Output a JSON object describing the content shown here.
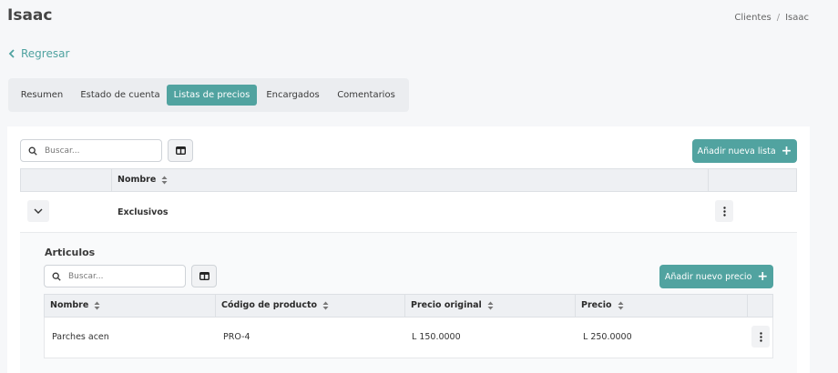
{
  "header": {
    "title": "Isaac",
    "breadcrumb": [
      "Clientes",
      "Isaac"
    ],
    "breadcrumb_separator": "/"
  },
  "back_link": {
    "label": "Regresar",
    "icon": "chevron-left-icon"
  },
  "tabs": [
    {
      "label": "Resumen",
      "active": false
    },
    {
      "label": "Estado de cuenta",
      "active": false
    },
    {
      "label": "Listas de precios",
      "active": true
    },
    {
      "label": "Encargados",
      "active": false
    },
    {
      "label": "Comentarios",
      "active": false
    }
  ],
  "price_lists": {
    "search": {
      "placeholder": "Buscar...",
      "value": ""
    },
    "add_button": {
      "label": "Añadir nueva lista",
      "icon": "plus-icon"
    },
    "columns": [
      "Nombre"
    ],
    "rows": [
      {
        "name": "Exclusivos",
        "expanded": true
      }
    ]
  },
  "articles": {
    "title": "Articulos",
    "search": {
      "placeholder": "Buscar...",
      "value": ""
    },
    "add_button": {
      "label": "Añadir nuevo precio",
      "icon": "plus-icon"
    },
    "columns": [
      "Nombre",
      "Código de producto",
      "Precio original",
      "Precio"
    ],
    "rows": [
      {
        "name": "Parches acen",
        "code": "PRO-4",
        "original_price": "L 150.0000",
        "price": "L 250.0000"
      }
    ]
  },
  "colors": {
    "accent": "#51a3a0",
    "link": "#4fa2a0",
    "background": "#f6f7f9",
    "header_bg": "#eef0f3"
  }
}
